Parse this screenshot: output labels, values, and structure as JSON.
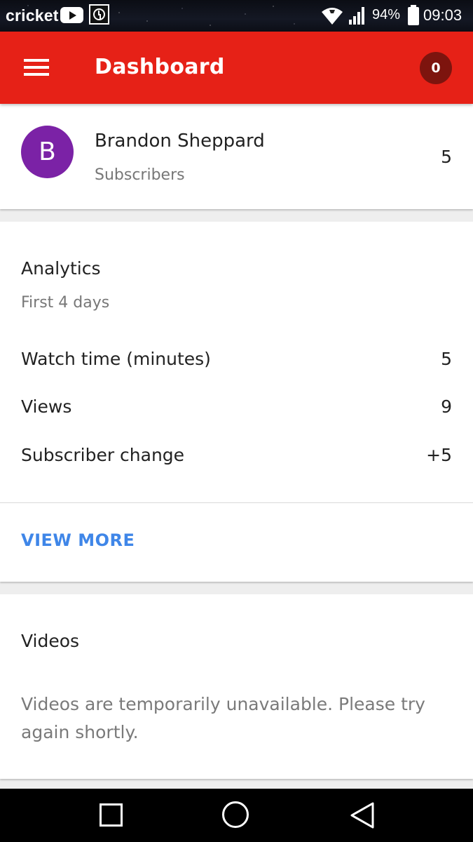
{
  "status_bar": {
    "carrier": "cricket",
    "icons": [
      "youtube-icon",
      "clock-app-icon",
      "wifi-icon",
      "signal-icon",
      "battery-icon"
    ],
    "battery": "94%",
    "time": "09:03"
  },
  "app_bar": {
    "title": "Dashboard",
    "notification_count": "0",
    "color": "#e62117"
  },
  "channel": {
    "avatar_letter": "B",
    "avatar_color": "#7b22a6",
    "name": "Brandon Sheppard",
    "subscribers_label": "Subscribers",
    "subscribers_count": "5"
  },
  "analytics": {
    "title": "Analytics",
    "period": "First 4 days",
    "metrics": [
      {
        "label": "Watch time (minutes)",
        "value": "5"
      },
      {
        "label": "Views",
        "value": "9"
      },
      {
        "label": "Subscriber change",
        "value": "+5"
      }
    ],
    "view_more": "VIEW MORE"
  },
  "videos": {
    "title": "Videos",
    "message": "Videos are temporarily unavailable. Please try again shortly."
  },
  "nav_bar": {
    "icons": [
      "recent-apps-icon",
      "home-icon",
      "back-icon"
    ]
  }
}
